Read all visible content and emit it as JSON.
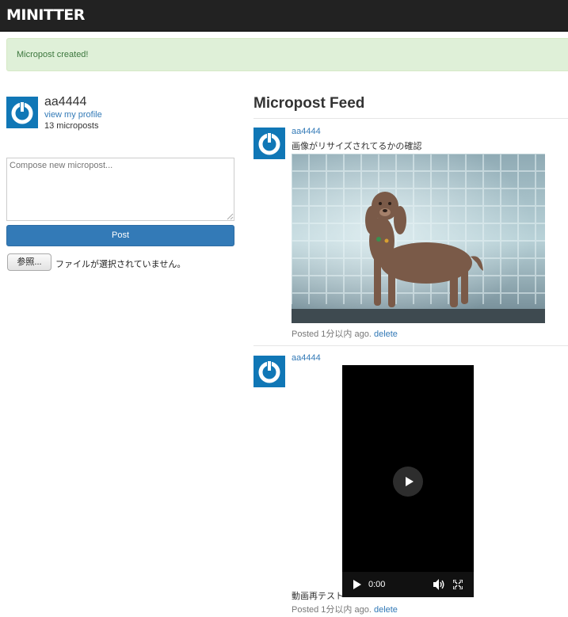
{
  "navbar": {
    "brand": "MINITTER"
  },
  "alert": {
    "message": "Micropost created!"
  },
  "user_info": {
    "name": "aa4444",
    "profile_link": "view my profile",
    "post_count": "13 microposts"
  },
  "compose": {
    "placeholder": "Compose new micropost...",
    "post_button": "Post",
    "browse_button": "参照...",
    "file_status": "ファイルが選択されていません。"
  },
  "feed": {
    "title": "Micropost Feed",
    "posts": [
      {
        "user": "aa4444",
        "content": "画像がリサイズされてるかの確認",
        "timestamp": "Posted 1分以内 ago.",
        "delete_label": "delete",
        "media": "dog-photo"
      },
      {
        "user": "aa4444",
        "content": "動画再テスト",
        "timestamp": "Posted 1分以内 ago.",
        "delete_label": "delete",
        "media": "video-player",
        "video_time": "0:00"
      }
    ]
  },
  "colors": {
    "navbar": "#222222",
    "link": "#337ab7",
    "alert_bg": "#dff0d8",
    "avatar": "#1077b6"
  }
}
